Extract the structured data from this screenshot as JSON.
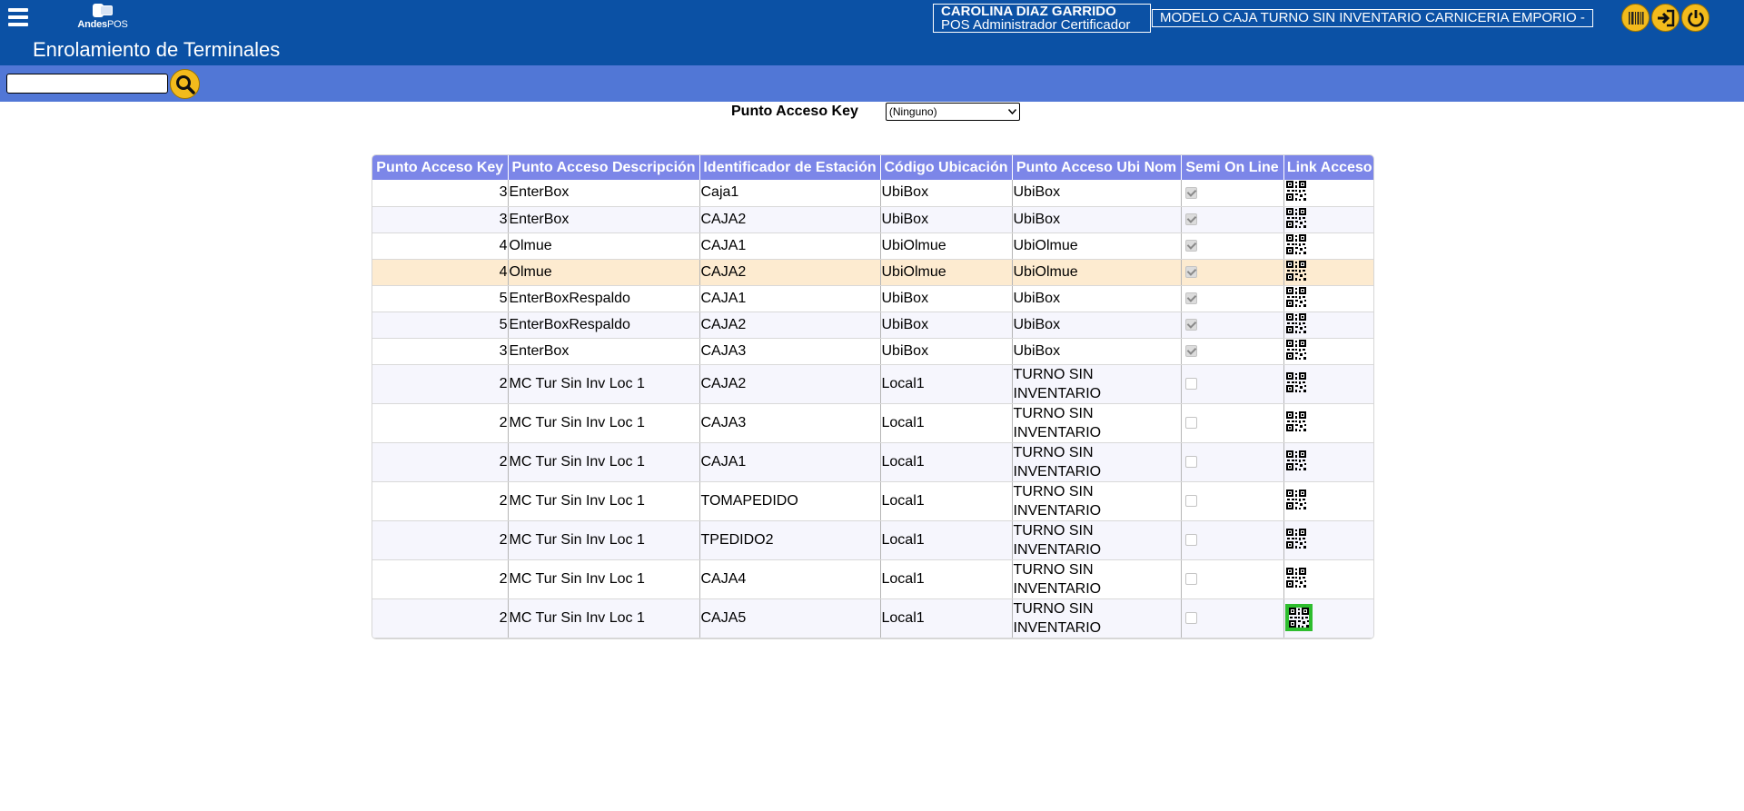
{
  "header": {
    "logo_text_bold": "Andes",
    "logo_text_thin": "POS",
    "title": "Enrolamiento de Terminales",
    "user_name": "CAROLINA DIAZ GARRIDO",
    "user_role": "POS Administrador Certificador",
    "model": "MODELO CAJA TURNO SIN INVENTARIO CARNICERIA EMPORIO -",
    "icons": [
      "barcode-icon",
      "login-icon",
      "power-icon"
    ],
    "bg_color": "#0b51a5"
  },
  "search": {
    "value": "",
    "placeholder": "",
    "bar_color": "#5177d6"
  },
  "filter": {
    "label": "Punto Acceso Key",
    "selected": "(Ninguno)"
  },
  "table": {
    "header_color": "#7c86e8",
    "highlight_color": "#fdebd0",
    "columns": [
      "Punto Acceso Key",
      "Punto Acceso Descripción",
      "Identificador de Estación",
      "Código Ubicación",
      "Punto Acceso Ubi Nom",
      "Semi On Line",
      "Link Acceso"
    ],
    "rows": [
      {
        "key": "3",
        "desc": "EnterBox",
        "station": "Caja1",
        "loc_code": "UbiBox",
        "loc_name": "UbiBox",
        "semi_online": true,
        "selected": false
      },
      {
        "key": "3",
        "desc": "EnterBox",
        "station": "CAJA2",
        "loc_code": "UbiBox",
        "loc_name": "UbiBox",
        "semi_online": true,
        "selected": false
      },
      {
        "key": "4",
        "desc": "Olmue",
        "station": "CAJA1",
        "loc_code": "UbiOlmue",
        "loc_name": "UbiOlmue",
        "semi_online": true,
        "selected": false
      },
      {
        "key": "4",
        "desc": "Olmue",
        "station": "CAJA2",
        "loc_code": "UbiOlmue",
        "loc_name": "UbiOlmue",
        "semi_online": true,
        "selected": false,
        "highlight": true
      },
      {
        "key": "5",
        "desc": "EnterBoxRespaldo",
        "station": "CAJA1",
        "loc_code": "UbiBox",
        "loc_name": "UbiBox",
        "semi_online": true,
        "selected": false
      },
      {
        "key": "5",
        "desc": "EnterBoxRespaldo",
        "station": "CAJA2",
        "loc_code": "UbiBox",
        "loc_name": "UbiBox",
        "semi_online": true,
        "selected": false
      },
      {
        "key": "3",
        "desc": "EnterBox",
        "station": "CAJA3",
        "loc_code": "UbiBox",
        "loc_name": "UbiBox",
        "semi_online": true,
        "selected": false
      },
      {
        "key": "2",
        "desc": "MC Tur Sin Inv Loc 1",
        "station": "CAJA2",
        "loc_code": "Local1",
        "loc_name": "TURNO SIN INVENTARIO",
        "semi_online": false,
        "selected": false
      },
      {
        "key": "2",
        "desc": "MC Tur Sin Inv Loc 1",
        "station": "CAJA3",
        "loc_code": "Local1",
        "loc_name": "TURNO SIN INVENTARIO",
        "semi_online": false,
        "selected": false
      },
      {
        "key": "2",
        "desc": "MC Tur Sin Inv Loc 1",
        "station": "CAJA1",
        "loc_code": "Local1",
        "loc_name": "TURNO SIN INVENTARIO",
        "semi_online": false,
        "selected": false
      },
      {
        "key": "2",
        "desc": "MC Tur Sin Inv Loc 1",
        "station": "TOMAPEDIDO",
        "loc_code": "Local1",
        "loc_name": "TURNO SIN INVENTARIO",
        "semi_online": false,
        "selected": false
      },
      {
        "key": "2",
        "desc": "MC Tur Sin Inv Loc 1",
        "station": "TPEDIDO2",
        "loc_code": "Local1",
        "loc_name": "TURNO SIN INVENTARIO",
        "semi_online": false,
        "selected": false
      },
      {
        "key": "2",
        "desc": "MC Tur Sin Inv Loc 1",
        "station": "CAJA4",
        "loc_code": "Local1",
        "loc_name": "TURNO SIN INVENTARIO",
        "semi_online": false,
        "selected": false
      },
      {
        "key": "2",
        "desc": "MC Tur Sin Inv Loc 1",
        "station": "CAJA5",
        "loc_code": "Local1",
        "loc_name": "TURNO SIN INVENTARIO",
        "semi_online": false,
        "selected": true
      }
    ]
  }
}
